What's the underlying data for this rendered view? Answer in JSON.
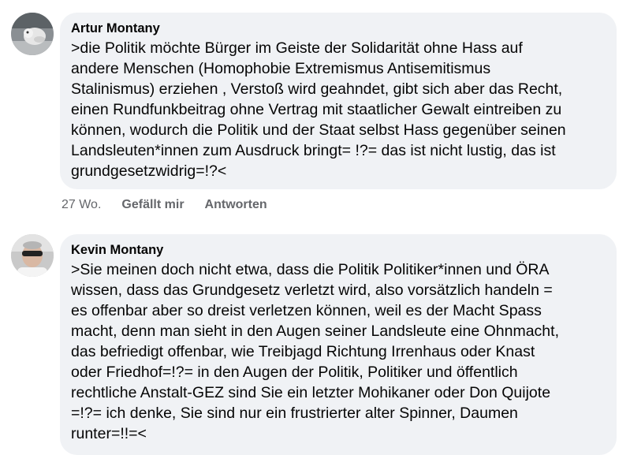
{
  "comments": [
    {
      "author": "Artur Montany",
      "text": ">die Politik möchte Bürger im Geiste der Solidarität ohne Hass auf\nandere Menschen (Homophobie Extremismus Antisemitismus\nStalinismus)  erziehen , Verstoß wird geahndet,  gibt sich aber das Recht,\neinen Rundfunkbeitrag  ohne Vertrag mit staatlicher Gewalt eintreiben zu\nkönnen, wodurch die Politik und der Staat selbst Hass gegenüber seinen\nLandsleuten*innen zum Ausdruck bringt= !?= das ist nicht lustig, das ist\ngrundgesetzwidrig=!?<",
      "time": "27 Wo.",
      "like_label": "Gefällt mir",
      "reply_label": "Antworten"
    },
    {
      "author": "Kevin Montany",
      "text": ">Sie meinen doch nicht etwa, dass die Politik Politiker*innen und ÖRA\nwissen, dass das Grundgesetz verletzt wird, also vorsätzlich handeln =\nes offenbar aber so dreist  verletzen können, weil es der Macht  Spass\nmacht, denn man sieht in den Augen seiner Landsleute eine Ohnmacht,\ndas befriedigt offenbar, wie Treibjagd Richtung Irrenhaus oder Knast\noder Friedhof=!?= in den Augen der Politik, Politiker und öffentlich\nrechtliche Anstalt-GEZ sind Sie ein letzter Mohikaner oder Don Quijote\n=!?= ich denke, Sie sind nur ein frustrierter alter Spinner, Daumen\nrunter=!!=<"
    }
  ]
}
